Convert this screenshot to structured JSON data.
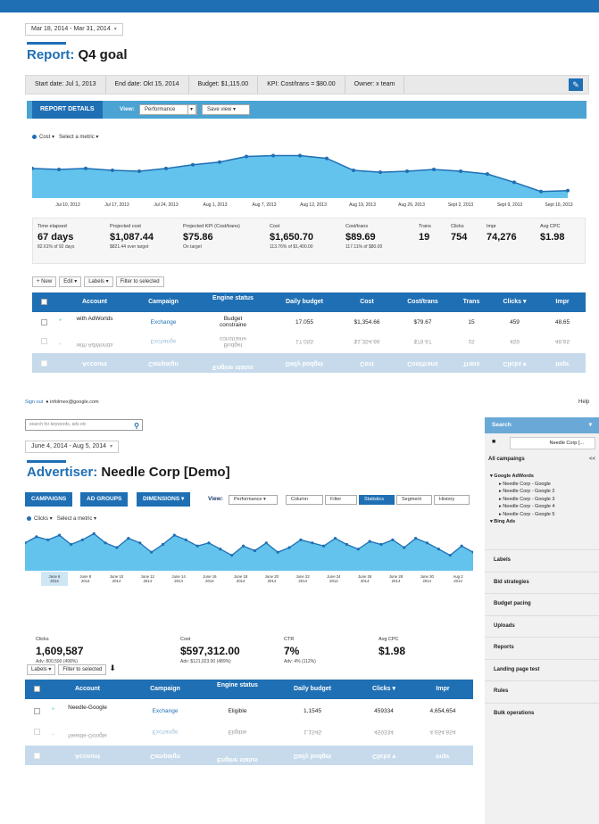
{
  "report": {
    "date_range": "Mar 18, 2014 - Mar 31, 2014",
    "title_label": "Report:",
    "title_name": "Q4 goal",
    "info": {
      "start": "Start date: Jul 1, 2013",
      "end": "End date: Okt 15, 2014",
      "budget": "Budget: $1,115.00",
      "kpi": "KPI: Cost/trans = $80.00",
      "owner": "Owner: x team"
    },
    "tab_active": "REPORT DETAILS",
    "view_label": "View:",
    "view_select": "Performance",
    "save_view": "Save view",
    "metric_primary": "Cost",
    "metric_select": "Select a metric",
    "chart_data": {
      "type": "area",
      "series": [
        {
          "name": "Cost",
          "values": [
            62,
            61,
            62,
            60,
            59,
            62,
            66,
            69,
            75,
            76,
            76,
            73,
            60,
            58,
            59,
            61,
            59,
            56,
            47,
            37,
            38
          ]
        }
      ],
      "x_ticks": [
        "Jul 10, 2013",
        "Jul 17, 2013",
        "Jul 24, 2013",
        "Aug 1, 2013",
        "Aug 7, 2013",
        "Aug 12, 2013",
        "Aug 19, 2013",
        "Aug 26, 2013",
        "Sept 2, 2013",
        "Sept 9, 2013",
        "Sept 16, 2013"
      ],
      "y_ticks": [
        "$300",
        "$100"
      ]
    },
    "stats": [
      {
        "h": "Time elapsed",
        "v": "67 days",
        "sub": "82.61% of 92 days"
      },
      {
        "h": "Projected cost",
        "v": "$1,087.44",
        "sub": "$821.44 over target"
      },
      {
        "h": "Projected KPI (Cost/trans)",
        "v": "$75.86",
        "sub": "On target"
      },
      {
        "h": "Cost",
        "v": "$1,650.70",
        "sub": "113.76% of $1,400.00"
      },
      {
        "h": "Cost/trans",
        "v": "$89.69",
        "sub": "117.11% of $80.00"
      },
      {
        "h": "Trans",
        "v": "19",
        "sub": ""
      },
      {
        "h": "Clicks",
        "v": "754",
        "sub": ""
      },
      {
        "h": "Impr",
        "v": "74,276",
        "sub": ""
      },
      {
        "h": "Avg CPC",
        "v": "$1.98",
        "sub": ""
      }
    ],
    "buttons": {
      "new": "+ New",
      "edit": "Edit",
      "labels": "Labels",
      "filter": "Filter to selected"
    },
    "columns": [
      "Account",
      "Campaign",
      "Engine status",
      "Daily budget",
      "Cost",
      "Cost/trans",
      "Trans",
      "Clicks ▾",
      "Impr"
    ],
    "rows": [
      {
        "account": "with AdWorlds",
        "campaign": "Exchange",
        "status": "Budget constraine",
        "budget": "17.055",
        "cost": "$1,354.66",
        "ct": "$79.67",
        "trans": "15",
        "clicks": "459",
        "impr": "48,65"
      }
    ]
  },
  "advertiser": {
    "sign_out": "Sign out",
    "email": "infolmex@google.com",
    "help": "Help",
    "search_placeholder": "search for keywords, ads etc",
    "date_range": "June 4, 2014 - Aug 5, 2014",
    "title_label": "Advertiser:",
    "title_name": "Needle Corp [Demo]",
    "tabs": [
      "CAMPAIGNS",
      "AD GROUPS",
      "DIMENSIONS"
    ],
    "view_label": "View:",
    "view_select": "Performance",
    "view_buttons": [
      "Column",
      "Filter",
      "Statistics",
      "Segment",
      "History"
    ],
    "metric_primary": "Clicks",
    "metric_select": "Select a metric",
    "chart_data": {
      "type": "line",
      "series": [
        {
          "name": "Clicks",
          "values": [
            58,
            62,
            60,
            63,
            57,
            60,
            64,
            58,
            55,
            61,
            58,
            52,
            57,
            63,
            60,
            56,
            58,
            54,
            50,
            56,
            53,
            58,
            52,
            55,
            60,
            58,
            56,
            61,
            57,
            54,
            59,
            57,
            60,
            55,
            61,
            58,
            54,
            50,
            56,
            52
          ]
        }
      ],
      "x_ticks": [
        "June 6, 2014",
        "June 8 2014",
        "June 10 2014",
        "June 12 2014",
        "June 14 2014",
        "June 16 2014",
        "June 18 2014",
        "June 20 2014",
        "June 22 2014",
        "June 24 2014",
        "June 26 2014",
        "June 28 2014",
        "June 30 2014",
        "Aug 2 2014"
      ]
    },
    "stats": [
      {
        "h": "Clicks",
        "v": "1,609,587",
        "sub": "Adv: 800,590 (498%)"
      },
      {
        "h": "Cost",
        "v": "$597,312.00",
        "sub": "Adv: $121,023.00 (489%)"
      },
      {
        "h": "CTR",
        "v": "7%",
        "sub": "Adv: 4% (112%)"
      },
      {
        "h": "Avg CPC",
        "v": "$1.98",
        "sub": ""
      }
    ],
    "buttons": {
      "labels": "Labels",
      "filter": "Filter to selected"
    },
    "columns": [
      "Account",
      "Campaign",
      "Engine status",
      "Daily budget",
      "Clicks ▾",
      "Impr"
    ],
    "rows": [
      {
        "account": "Needle-Google",
        "campaign": "Exchange",
        "status": "Eligible",
        "budget": "1,1545",
        "clicks": "459334",
        "impr": "4,654,654"
      }
    ],
    "sidebar": {
      "search": "Search",
      "account": "Needle Corp [...",
      "all_campaigns": "All campaings",
      "collapse": "<<",
      "group1": "Google AdWords",
      "items": [
        "Needle Corp - Google",
        "Needle Corp - Google 2",
        "Needle Corp - Google 3",
        "Needle Corp - Google 4",
        "Needle Corp - Google 5"
      ],
      "group2": "Bing Ads",
      "sections": [
        "Labels",
        "Bid strategies",
        "Budget pacing",
        "Uploads",
        "Reports",
        "Landing page test",
        "Rules",
        "Bulk operations"
      ]
    }
  }
}
